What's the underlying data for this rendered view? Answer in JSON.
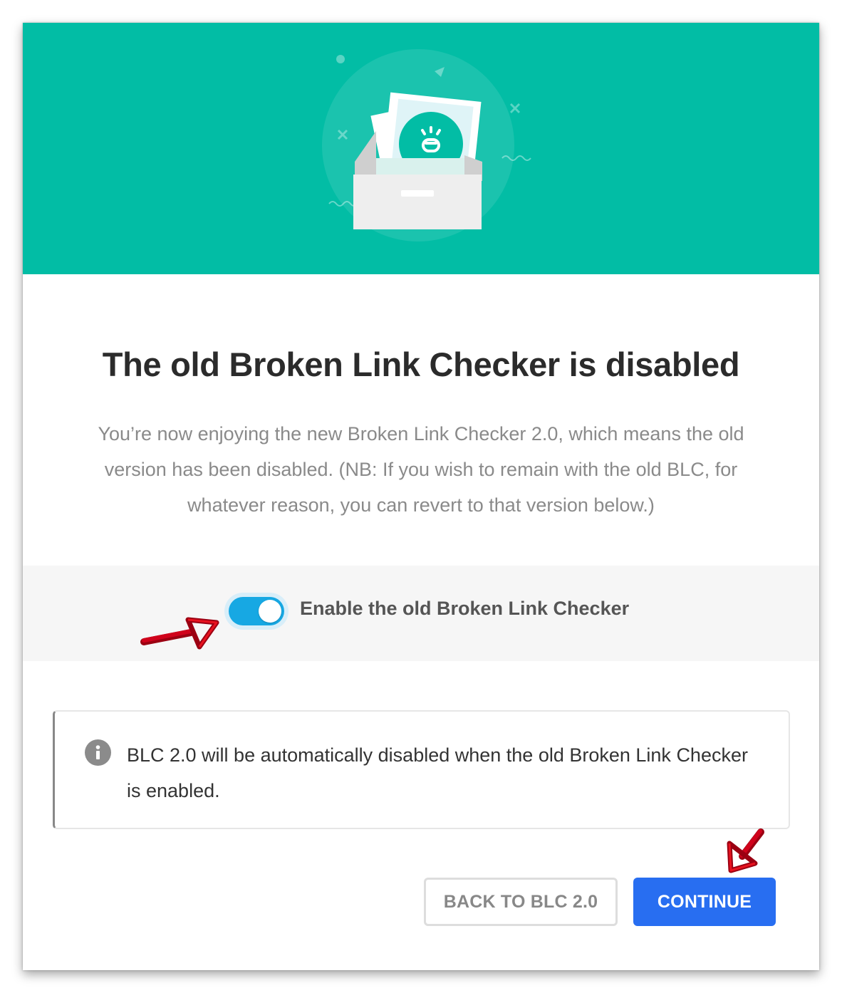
{
  "dialog": {
    "title": "The old Broken Link Checker is disabled",
    "description": "You’re now enjoying the new Broken Link Checker 2.0, which means the old version has been disabled. (NB: If you wish to remain with the old BLC, for whatever reason, you can revert to that version below.)",
    "toggle": {
      "label": "Enable the old Broken Link Checker",
      "checked": true
    },
    "notice": {
      "icon": "info-icon",
      "text": "BLC 2.0 will be automatically disabled when the old Broken Link Checker is enabled."
    },
    "buttons": {
      "back_label": "BACK TO BLC 2.0",
      "continue_label": "CONTINUE"
    },
    "hero_icon": "archive-box-illustration"
  },
  "colors": {
    "hero_bg": "#02bda5",
    "toggle_on": "#17a8e3",
    "primary_button": "#286ef1",
    "annotation_arrow": "#d0021b"
  }
}
